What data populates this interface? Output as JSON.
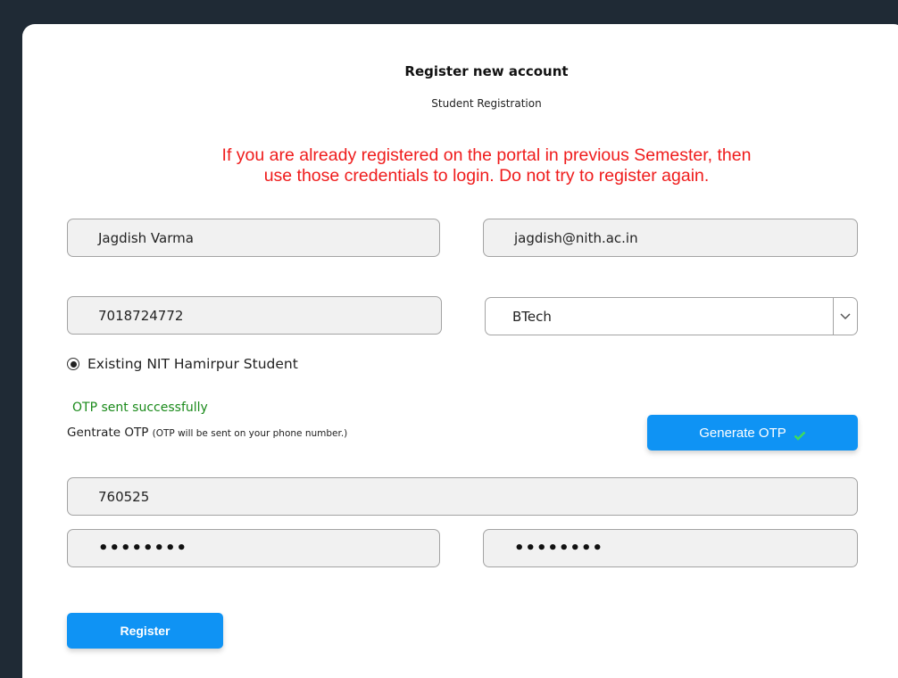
{
  "header": {
    "title": "Register new account",
    "subtitle": "Student Registration"
  },
  "notice": {
    "line1": "If you are already registered on the portal in previous Semester, then",
    "line2": "use those credentials to login. Do not try to register again.",
    "color": "#ef1c1c"
  },
  "form": {
    "name_value": "Jagdish Varma",
    "email_value": "jagdish@nith.ac.in",
    "phone_value": "7018724772",
    "program_selected": "BTech",
    "student_type_label": "Existing NIT Hamirpur Student",
    "otp_status": "OTP sent successfully",
    "otp_label": "Gentrate OTP",
    "otp_hint": "(OTP will be sent on your phone number.)",
    "generate_otp_label": "Generate OTP",
    "otp_value": "760525",
    "password_mask": "••••••••",
    "confirm_password_mask": "••••••••",
    "register_label": "Register"
  },
  "colors": {
    "accent": "#0f93f4",
    "success": "#1a8a1a",
    "background": "#1f2a35"
  },
  "icons": {
    "chevron": "chevron-down-icon",
    "check": "check-icon",
    "radio": "radio-selected-icon"
  }
}
